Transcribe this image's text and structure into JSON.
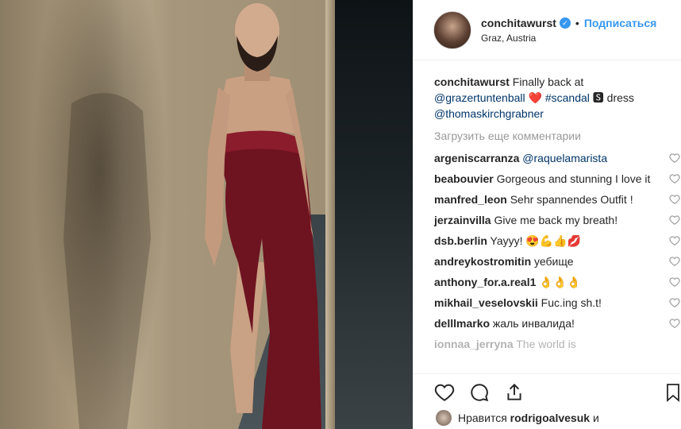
{
  "post": {
    "username": "conchitawurst",
    "follow_label": "Подписаться",
    "location": "Graz, Austria",
    "caption": {
      "username": "conchitawurst",
      "text_1": "Finally back at",
      "mention_1": "@grazertuntenball",
      "heart": "❤️",
      "hashtag": "#scandal",
      "badge": "🆂",
      "text_2": "dress",
      "mention_2": "@thomaskirchgrabner"
    },
    "load_more_label": "Загрузить еще комментарии"
  },
  "comments": [
    {
      "user": "argeniscarranza",
      "text": "@raquelamarista",
      "is_link": true
    },
    {
      "user": "beabouvier",
      "text": "Gorgeous and stunning I love it"
    },
    {
      "user": "manfred_leon",
      "text": "Sehr spannendes Outfit !"
    },
    {
      "user": "jerzainvilla",
      "text": "Give me back my breath!"
    },
    {
      "user": "dsb.berlin",
      "text": "Yayyy! 😍💪👍💋"
    },
    {
      "user": "andreykostromitin",
      "text": "уебище"
    },
    {
      "user": "anthony_for.a.real1",
      "text": "👌👌👌"
    },
    {
      "user": "mikhail_veselovskii",
      "text": "Fuc.ing sh.t!"
    },
    {
      "user": "delllmarko",
      "text": "жаль инвалида!"
    },
    {
      "user": "ionnaa_jerryna",
      "text": "The world is"
    }
  ],
  "likes": {
    "prefix": "Нравится",
    "user": "rodrigoalvesuk",
    "suffix": "и"
  },
  "icons": {
    "verified": "verified-badge-icon",
    "like": "heart-icon",
    "comment": "comment-icon",
    "share": "share-icon",
    "save": "bookmark-icon"
  },
  "colors": {
    "link": "#003569",
    "accent": "#3897f0",
    "muted": "#999999"
  }
}
